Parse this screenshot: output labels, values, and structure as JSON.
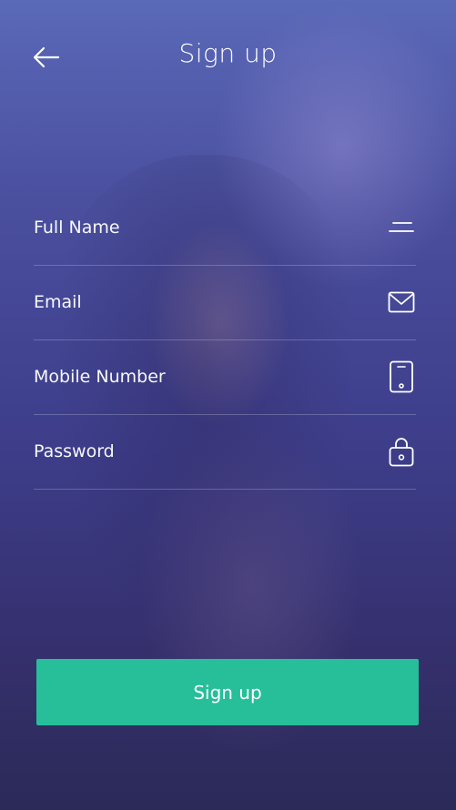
{
  "header": {
    "title": "Sign up",
    "back_icon": "arrow-left-icon"
  },
  "form": {
    "fields": [
      {
        "label": "Full Name",
        "icon": "name-lines-icon"
      },
      {
        "label": "Email",
        "icon": "envelope-icon"
      },
      {
        "label": "Mobile Number",
        "icon": "phone-icon"
      },
      {
        "label": "Password",
        "icon": "lock-icon"
      }
    ]
  },
  "submit": {
    "label": "Sign up",
    "color": "#27be9a"
  },
  "theme": {
    "overlay": "#3d3d8a"
  }
}
